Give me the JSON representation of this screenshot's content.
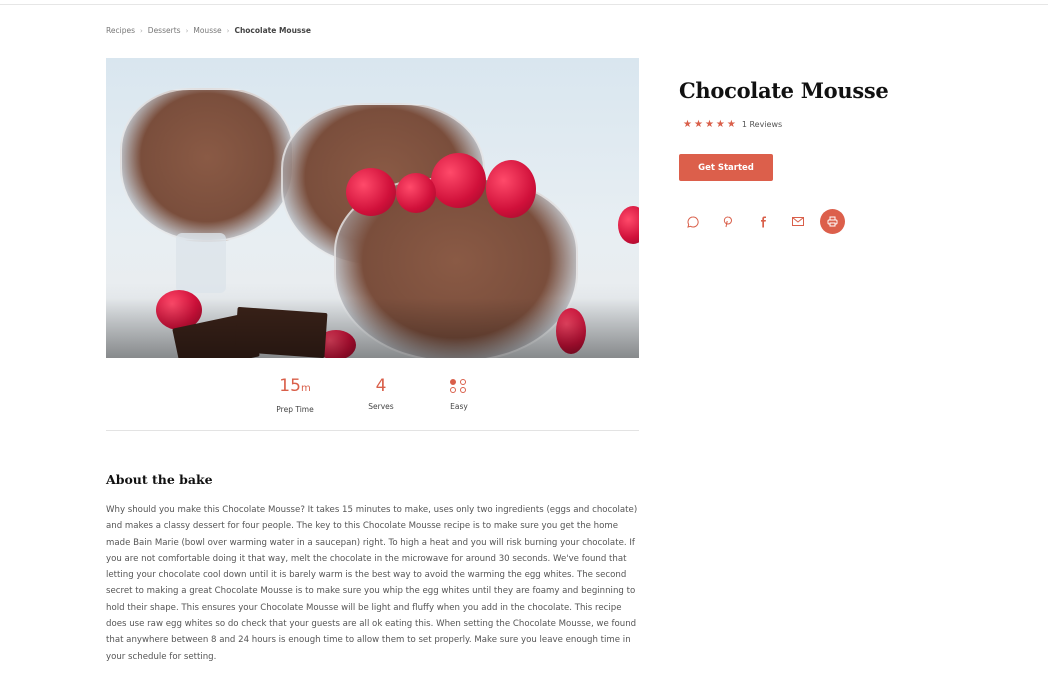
{
  "breadcrumb": {
    "items": [
      "Recipes",
      "Desserts",
      "Mousse"
    ],
    "current": "Chocolate Mousse",
    "separator": "›"
  },
  "recipe": {
    "title": "Chocolate Mousse",
    "rating": 5,
    "reviews_label": "1 Reviews",
    "cta_label": "Get Started",
    "share_icons": [
      "whatsapp-icon",
      "pinterest-icon",
      "facebook-icon",
      "email-icon",
      "print-icon"
    ]
  },
  "stats": {
    "prep": {
      "value": "15",
      "unit": "m",
      "label": "Prep Time"
    },
    "serves": {
      "value": "4",
      "label": "Serves"
    },
    "difficulty": {
      "label": "Easy",
      "level": 1,
      "max": 4
    }
  },
  "about": {
    "heading": "About the bake",
    "text": "Why should you make this Chocolate Mousse? It takes 15 minutes to make, uses only two ingredients (eggs and chocolate) and makes a classy dessert for four people. The key to this Chocolate Mousse recipe is to make sure you get the home made Bain Marie (bowl over warming water in a saucepan) right. To high a heat and you will risk burning your chocolate. If you are not comfortable doing it that way, melt the chocolate in the microwave for around 30 seconds. We've found that letting your chocolate cool down until it is barely warm is the best way to avoid the warming the egg whites. The second secret to making a great Chocolate Mousse is to make sure you whip the egg whites until they are foamy and beginning to hold their shape. This ensures your Chocolate Mousse will be light and fluffy when you add in the chocolate. This recipe does use raw egg whites so do check that your guests are all ok eating this. When setting the Chocolate Mousse, we found that anywhere between 8 and 24 hours is enough time to allow them to set properly. Make sure you leave enough time in your schedule for setting."
  },
  "colors": {
    "accent": "#dc5f4b",
    "text": "#333333",
    "heading": "#111111"
  }
}
